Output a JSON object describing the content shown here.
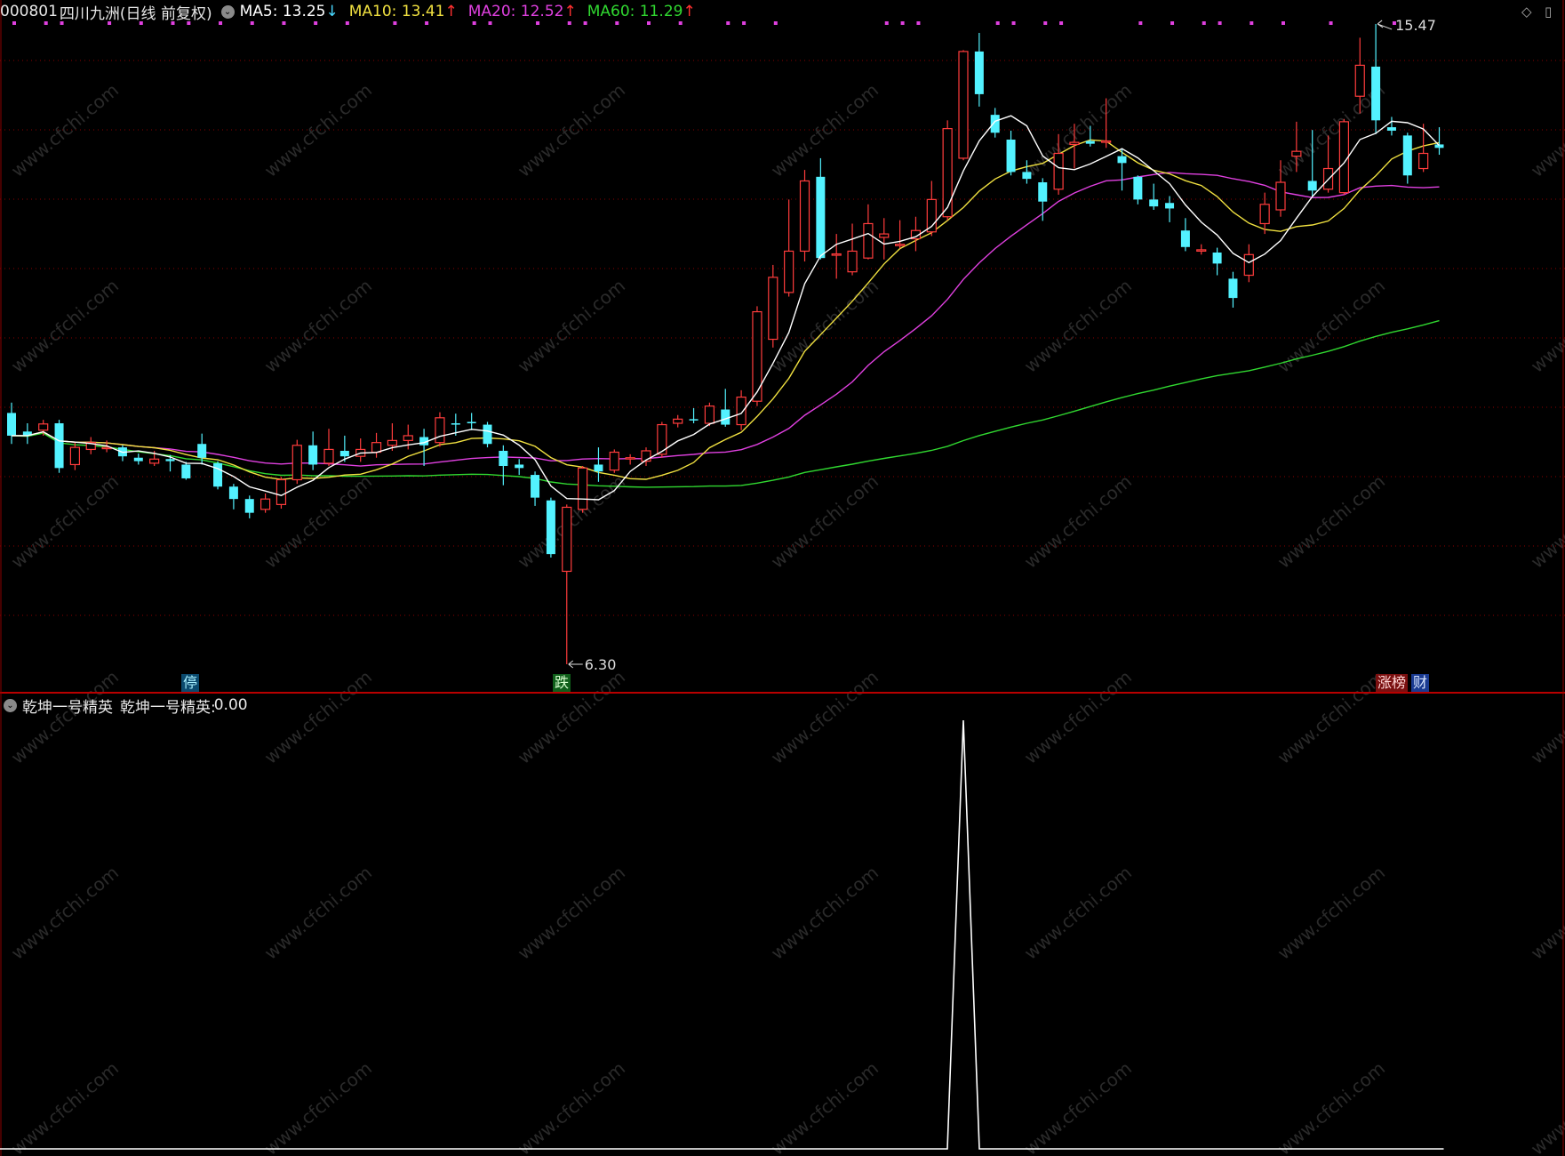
{
  "header": {
    "code": "000801",
    "name": "四川九洲",
    "period": "(日线 前复权)",
    "ma": [
      {
        "label": "MA5: ",
        "value": "13.25",
        "arrow": "↓",
        "color": "#ffffff",
        "arrow_color": "#49d8ff"
      },
      {
        "label": "MA10: ",
        "value": "13.41",
        "arrow": "↑",
        "color": "#f0e040",
        "arrow_color": "#ff3030"
      },
      {
        "label": "MA20: ",
        "value": "12.52",
        "arrow": "↑",
        "color": "#e040e0",
        "arrow_color": "#ff3030"
      },
      {
        "label": "MA60: ",
        "value": "11.29",
        "arrow": "↑",
        "color": "#30d830",
        "arrow_color": "#ff3030"
      }
    ]
  },
  "annotations": {
    "high": "15.47",
    "low": "6.30"
  },
  "badges": {
    "stop": "停",
    "drop": "跌",
    "rank": "涨榜",
    "finance": "财"
  },
  "indicator": {
    "name": "乾坤一号精英",
    "value_label": "乾坤一号精英: ",
    "value": "0.00"
  },
  "watermark": "www.cfchi.com",
  "colors": {
    "up": "#ff3c3c",
    "down": "#53f2ff",
    "ma5": "#ffffff",
    "ma10": "#f0e040",
    "ma20": "#e040e0",
    "ma60": "#30d830",
    "grid": "#8b0000",
    "separator": "#b80000"
  },
  "chart_data": {
    "type": "candlestick",
    "price_axis": {
      "min": 6.3,
      "max": 15.47
    },
    "candles": [
      {
        "o": 9.95,
        "c": 9.62,
        "h": 10.1,
        "l": 9.5
      },
      {
        "o": 9.68,
        "c": 9.62,
        "h": 9.8,
        "l": 9.5
      },
      {
        "o": 9.7,
        "c": 9.79,
        "h": 9.85,
        "l": 9.62
      },
      {
        "o": 9.8,
        "c": 9.15,
        "h": 9.85,
        "l": 9.08
      },
      {
        "o": 9.2,
        "c": 9.45,
        "h": 9.52,
        "l": 9.12
      },
      {
        "o": 9.42,
        "c": 9.52,
        "h": 9.6,
        "l": 9.35
      },
      {
        "o": 9.45,
        "c": 9.45,
        "h": 9.55,
        "l": 9.38
      },
      {
        "o": 9.45,
        "c": 9.32,
        "h": 9.48,
        "l": 9.25
      },
      {
        "o": 9.3,
        "c": 9.25,
        "h": 9.36,
        "l": 9.2
      },
      {
        "o": 9.22,
        "c": 9.28,
        "h": 9.4,
        "l": 9.18
      },
      {
        "o": 9.28,
        "c": 9.25,
        "h": 9.34,
        "l": 9.1
      },
      {
        "o": 9.2,
        "c": 9.0,
        "h": 9.24,
        "l": 8.98
      },
      {
        "o": 9.5,
        "c": 9.3,
        "h": 9.65,
        "l": 9.2
      },
      {
        "o": 9.22,
        "c": 8.88,
        "h": 9.25,
        "l": 8.84
      },
      {
        "o": 8.88,
        "c": 8.7,
        "h": 8.92,
        "l": 8.55
      },
      {
        "o": 8.7,
        "c": 8.5,
        "h": 8.75,
        "l": 8.42
      },
      {
        "o": 8.55,
        "c": 8.7,
        "h": 8.78,
        "l": 8.5
      },
      {
        "o": 8.62,
        "c": 8.98,
        "h": 9.02,
        "l": 8.56
      },
      {
        "o": 8.98,
        "c": 9.48,
        "h": 9.56,
        "l": 8.92
      },
      {
        "o": 9.48,
        "c": 9.2,
        "h": 9.68,
        "l": 9.12
      },
      {
        "o": 9.22,
        "c": 9.42,
        "h": 9.72,
        "l": 9.18
      },
      {
        "o": 9.4,
        "c": 9.32,
        "h": 9.62,
        "l": 9.24
      },
      {
        "o": 9.32,
        "c": 9.42,
        "h": 9.58,
        "l": 9.24
      },
      {
        "o": 9.38,
        "c": 9.52,
        "h": 9.66,
        "l": 9.3
      },
      {
        "o": 9.48,
        "c": 9.55,
        "h": 9.8,
        "l": 9.4
      },
      {
        "o": 9.55,
        "c": 9.62,
        "h": 9.78,
        "l": 9.42
      },
      {
        "o": 9.6,
        "c": 9.48,
        "h": 9.72,
        "l": 9.18
      },
      {
        "o": 9.52,
        "c": 9.88,
        "h": 9.96,
        "l": 9.46
      },
      {
        "o": 9.8,
        "c": 9.78,
        "h": 9.94,
        "l": 9.62
      },
      {
        "o": 9.82,
        "c": 9.8,
        "h": 9.95,
        "l": 9.7
      },
      {
        "o": 9.78,
        "c": 9.5,
        "h": 9.82,
        "l": 9.45
      },
      {
        "o": 9.4,
        "c": 9.18,
        "h": 9.48,
        "l": 8.9
      },
      {
        "o": 9.2,
        "c": 9.15,
        "h": 9.28,
        "l": 9.05
      },
      {
        "o": 9.05,
        "c": 8.72,
        "h": 9.1,
        "l": 8.6
      },
      {
        "o": 8.68,
        "c": 7.9,
        "h": 8.72,
        "l": 7.85
      },
      {
        "o": 7.65,
        "c": 8.58,
        "h": 8.62,
        "l": 6.3
      },
      {
        "o": 8.55,
        "c": 9.15,
        "h": 9.18,
        "l": 8.5
      },
      {
        "o": 9.2,
        "c": 9.1,
        "h": 9.45,
        "l": 8.95
      },
      {
        "o": 9.12,
        "c": 9.38,
        "h": 9.42,
        "l": 9.08
      },
      {
        "o": 9.3,
        "c": 9.3,
        "h": 9.35,
        "l": 9.2
      },
      {
        "o": 9.25,
        "c": 9.4,
        "h": 9.45,
        "l": 9.18
      },
      {
        "o": 9.35,
        "c": 9.78,
        "h": 9.82,
        "l": 9.3
      },
      {
        "o": 9.8,
        "c": 9.86,
        "h": 9.92,
        "l": 9.74
      },
      {
        "o": 9.86,
        "c": 9.85,
        "h": 10.02,
        "l": 9.8
      },
      {
        "o": 9.8,
        "c": 10.05,
        "h": 10.1,
        "l": 9.76
      },
      {
        "o": 10.0,
        "c": 9.78,
        "h": 10.3,
        "l": 9.75
      },
      {
        "o": 9.78,
        "c": 10.18,
        "h": 10.28,
        "l": 9.7
      },
      {
        "o": 10.12,
        "c": 11.42,
        "h": 11.5,
        "l": 10.05
      },
      {
        "o": 11.02,
        "c": 11.92,
        "h": 12.1,
        "l": 10.9
      },
      {
        "o": 11.7,
        "c": 12.3,
        "h": 13.05,
        "l": 11.64
      },
      {
        "o": 12.3,
        "c": 13.32,
        "h": 13.48,
        "l": 12.15
      },
      {
        "o": 13.38,
        "c": 12.2,
        "h": 13.65,
        "l": 12.18
      },
      {
        "o": 12.25,
        "c": 12.26,
        "h": 12.55,
        "l": 11.9
      },
      {
        "o": 12.0,
        "c": 12.3,
        "h": 12.7,
        "l": 11.95
      },
      {
        "o": 12.2,
        "c": 12.7,
        "h": 12.98,
        "l": 12.18
      },
      {
        "o": 12.5,
        "c": 12.55,
        "h": 12.78,
        "l": 12.18
      },
      {
        "o": 12.38,
        "c": 12.4,
        "h": 12.75,
        "l": 12.34
      },
      {
        "o": 12.48,
        "c": 12.6,
        "h": 12.8,
        "l": 12.3
      },
      {
        "o": 12.58,
        "c": 13.05,
        "h": 13.32,
        "l": 12.52
      },
      {
        "o": 12.8,
        "c": 14.08,
        "h": 14.2,
        "l": 12.75
      },
      {
        "o": 13.65,
        "c": 15.2,
        "h": 15.22,
        "l": 13.62
      },
      {
        "o": 15.2,
        "c": 14.58,
        "h": 15.47,
        "l": 14.4
      },
      {
        "o": 14.28,
        "c": 14.02,
        "h": 14.38,
        "l": 13.95
      },
      {
        "o": 13.92,
        "c": 13.45,
        "h": 14.05,
        "l": 13.4
      },
      {
        "o": 13.45,
        "c": 13.35,
        "h": 13.62,
        "l": 13.28
      },
      {
        "o": 13.3,
        "c": 13.02,
        "h": 13.36,
        "l": 12.74
      },
      {
        "o": 13.2,
        "c": 13.72,
        "h": 14.0,
        "l": 13.12
      },
      {
        "o": 13.85,
        "c": 13.88,
        "h": 14.15,
        "l": 13.5
      },
      {
        "o": 13.9,
        "c": 13.86,
        "h": 14.12,
        "l": 13.82
      },
      {
        "o": 13.9,
        "c": 13.9,
        "h": 14.52,
        "l": 13.8
      },
      {
        "o": 13.68,
        "c": 13.58,
        "h": 13.78,
        "l": 13.18
      },
      {
        "o": 13.38,
        "c": 13.05,
        "h": 13.4,
        "l": 12.98
      },
      {
        "o": 13.05,
        "c": 12.95,
        "h": 13.28,
        "l": 12.9
      },
      {
        "o": 13.0,
        "c": 12.92,
        "h": 13.1,
        "l": 12.72
      },
      {
        "o": 12.6,
        "c": 12.36,
        "h": 12.78,
        "l": 12.3
      },
      {
        "o": 12.32,
        "c": 12.32,
        "h": 12.4,
        "l": 12.25
      },
      {
        "o": 12.28,
        "c": 12.12,
        "h": 12.35,
        "l": 11.95
      },
      {
        "o": 11.9,
        "c": 11.62,
        "h": 12.0,
        "l": 11.48
      },
      {
        "o": 11.95,
        "c": 12.25,
        "h": 12.4,
        "l": 11.85
      },
      {
        "o": 12.7,
        "c": 12.98,
        "h": 13.15,
        "l": 12.55
      },
      {
        "o": 12.9,
        "c": 13.3,
        "h": 13.62,
        "l": 12.8
      },
      {
        "o": 13.68,
        "c": 13.75,
        "h": 14.18,
        "l": 13.45
      },
      {
        "o": 13.32,
        "c": 13.18,
        "h": 14.06,
        "l": 13.1
      },
      {
        "o": 13.2,
        "c": 13.5,
        "h": 13.98,
        "l": 13.15
      },
      {
        "o": 13.15,
        "c": 14.18,
        "h": 14.22,
        "l": 13.12
      },
      {
        "o": 14.55,
        "c": 15.0,
        "h": 15.4,
        "l": 14.3
      },
      {
        "o": 14.98,
        "c": 14.2,
        "h": 15.6,
        "l": 14.0
      },
      {
        "o": 14.1,
        "c": 14.05,
        "h": 14.25,
        "l": 13.98
      },
      {
        "o": 13.98,
        "c": 13.4,
        "h": 14.02,
        "l": 13.28
      },
      {
        "o": 13.5,
        "c": 13.72,
        "h": 14.15,
        "l": 13.45
      },
      {
        "o": 13.85,
        "c": 13.8,
        "h": 14.1,
        "l": 13.7
      }
    ],
    "ma5_last": 13.25,
    "ma10_last": 13.41,
    "ma20_last": 12.52,
    "ma60_last": 11.29,
    "signal": {
      "peak_index": 60,
      "peak_value": 1.0,
      "baseline": 0.0
    }
  }
}
